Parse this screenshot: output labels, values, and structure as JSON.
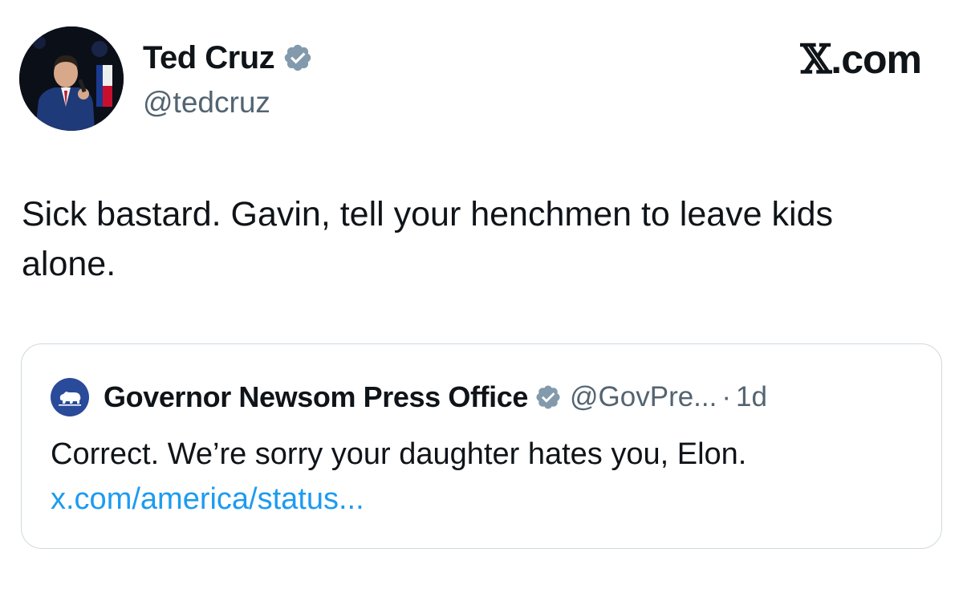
{
  "tweet": {
    "author": {
      "name": "Ted Cruz",
      "handle": "@tedcruz",
      "verified": true
    },
    "brand": {
      "x_mark": "𝕏",
      "domain": ".com"
    },
    "text": "Sick bastard. Gavin, tell your henchmen to leave kids alone."
  },
  "quote": {
    "author": {
      "name": "Governor Newsom Press Office",
      "handle": "@GovPre...",
      "verified": true,
      "avatar_icon": "california-bear-icon"
    },
    "separator": "·",
    "time": "1d",
    "text": "Correct. We’re sorry your daughter hates you, Elon.",
    "link": "x.com/america/status..."
  },
  "colors": {
    "text": "#0f1419",
    "secondary": "#536471",
    "link": "#1d9bf0",
    "verified_badge": "#829aab",
    "card_border": "#cfd9de",
    "quote_avatar_bg": "#2a4a9a"
  }
}
